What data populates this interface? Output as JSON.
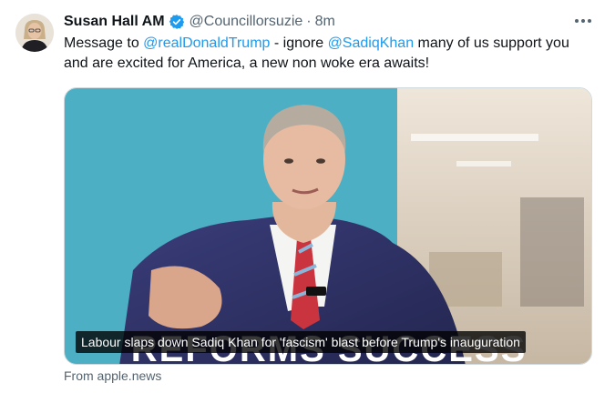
{
  "tweet": {
    "author": {
      "display_name": "Susan Hall AM",
      "handle": "@Councillorsuzie",
      "verified": true
    },
    "separator": "·",
    "time": "8m",
    "text": {
      "part1": "Message to ",
      "mention1": "@realDonaldTrump",
      "part2": "  - ignore ",
      "mention2": "@SadiqKhan",
      "part3": " many of us support you and are excited for America, a new non woke era awaits!"
    },
    "media": {
      "caption": "Labour slaps down Sadiq Khan for 'fascism' blast before Trump's inauguration",
      "background_text": "REFORMS SUCCESS"
    },
    "source": "From apple.news"
  },
  "icons": [
    "verified-badge-icon",
    "more-options-icon"
  ],
  "colors": {
    "accent": "#1d9bf0",
    "text": "#0f1419",
    "secondary": "#536471"
  }
}
